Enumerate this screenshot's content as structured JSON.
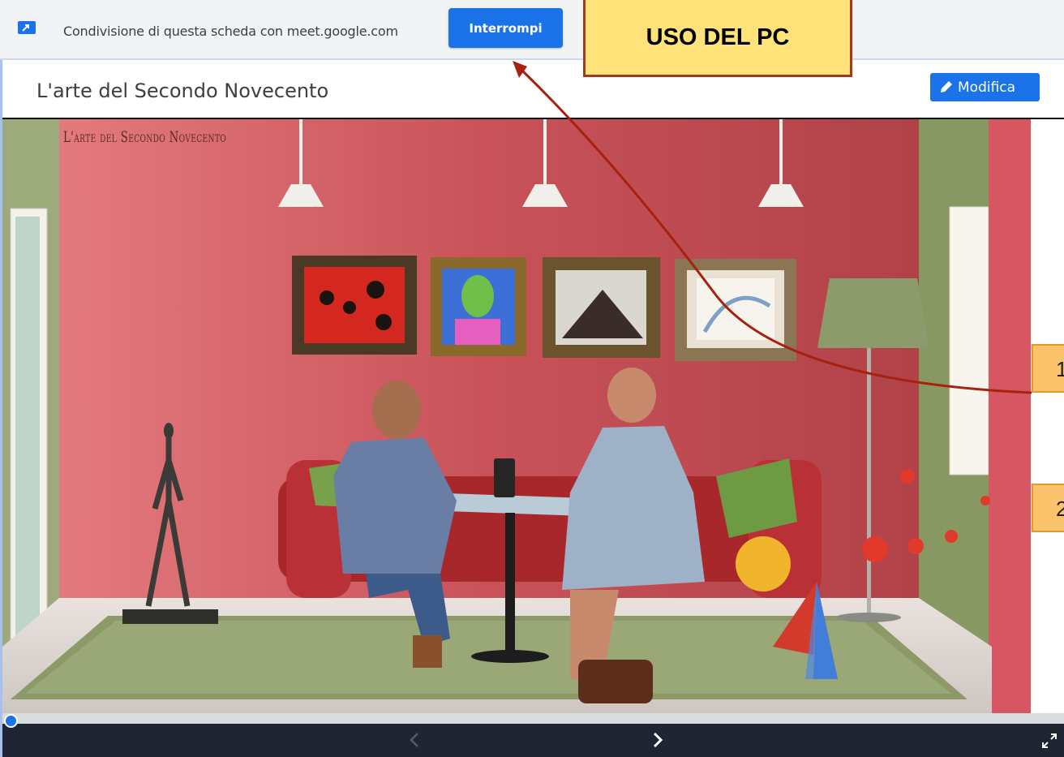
{
  "sharebar": {
    "message": "Condivisione di questa scheda con meet.google.com",
    "stop_label": "Interrompi"
  },
  "callouts": {
    "top_label": "USO DEL PC",
    "side_1": "1",
    "side_2": "2"
  },
  "presentation": {
    "title": "L'arte del Secondo Novecento",
    "edit_label": "Modifica",
    "slide_heading": "L'arte del Secondo Novecento"
  },
  "colors": {
    "accent": "#1a73e8",
    "callout_fill": "#ffe27a",
    "callout_border": "#a23a1c",
    "wall": "#c2525b",
    "controls_bg": "#1f2532"
  },
  "icons": {
    "share": "screen-share-icon",
    "edit": "pencil-icon",
    "prev": "chevron-left-icon",
    "next": "chevron-right-icon",
    "fullscreen": "fullscreen-icon"
  }
}
